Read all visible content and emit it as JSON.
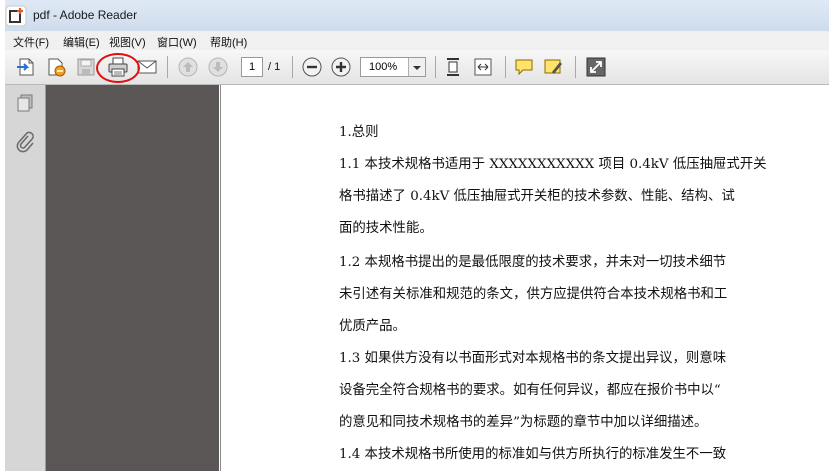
{
  "window": {
    "title": "pdf - Adobe Reader"
  },
  "menu": [
    {
      "label": "文件(F)"
    },
    {
      "label": "编辑(E)"
    },
    {
      "label": "视图(V)"
    },
    {
      "label": "窗口(W)"
    },
    {
      "label": "帮助(H)"
    }
  ],
  "toolbar": {
    "page_current": "1",
    "page_total": "/ 1",
    "zoom": "100%"
  },
  "document": {
    "lines": [
      "1.总则",
      "1.1 本技术规格书适用于 XXXXXXXXXXX 项目 0.4kV 低压抽屉式开关",
      "格书描述了 0.4kV 低压抽屉式开关柜的技术参数、性能、结构、试",
      "面的技术性能。",
      "1.2 本规格书提出的是最低限度的技术要求，并未对一切技术细节",
      "未引述有关标准和规范的条文，供方应提供符合本技术规格书和工",
      "优质产品。",
      "1.3 如果供方没有以书面形式对本规格书的条文提出异议，则意味",
      "设备完全符合规格书的要求。如有任何异议，都应在报价书中以“",
      "的意见和同技术规格书的差异”为标题的章节中加以详细描述。",
      "1.4 本技术规格书所使用的标准如与供方所执行的标准发生不一致"
    ]
  },
  "colors": {
    "nav_panel": "#5a5656",
    "highlight_circle": "#e01010"
  }
}
